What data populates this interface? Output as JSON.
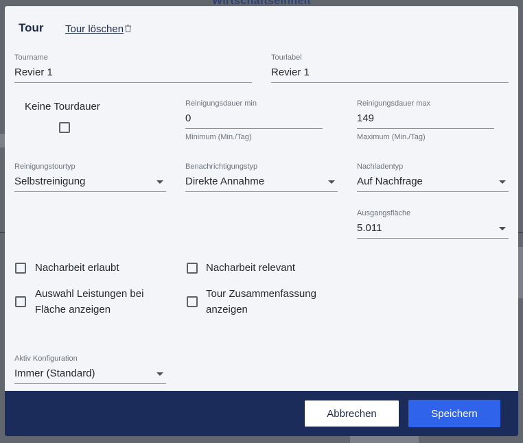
{
  "background": {
    "page_title": "Wirtschaftseinheit"
  },
  "dialog": {
    "title": "Tour",
    "delete_link": "Tour löschen",
    "tourname": {
      "label": "Tourname",
      "value": "Revier 1"
    },
    "tourlabel": {
      "label": "Tourlabel",
      "value": "Revier 1"
    },
    "keine_tourdauer": {
      "label": "Keine Tourdauer",
      "checked": false
    },
    "reinigungsdauer_min": {
      "label": "Reinigungsdauer min",
      "value": "0",
      "hint": "Minimum (Min./Tag)"
    },
    "reinigungsdauer_max": {
      "label": "Reinigungsdauer max",
      "value": "149",
      "hint": "Maximum (Min./Tag)"
    },
    "reinigungstourtyp": {
      "label": "Reinigungstourtyp",
      "value": "Selbstreinigung"
    },
    "benachrichtigungstyp": {
      "label": "Benachrichtigungstyp",
      "value": "Direkte Annahme"
    },
    "nachladentyp": {
      "label": "Nachladentyp",
      "value": "Auf Nachfrage"
    },
    "ausgangsflaeche": {
      "label": "Ausgangsfläche",
      "value": "5.011"
    },
    "checkboxes": {
      "nacharbeit_erlaubt": {
        "label": "Nacharbeit erlaubt",
        "checked": false
      },
      "nacharbeit_relevant": {
        "label": "Nacharbeit relevant",
        "checked": false
      },
      "auswahl_leistungen": {
        "line1": "Auswahl Leistungen bei",
        "line2": "Fläche anzeigen",
        "checked": false
      },
      "tour_zusammenfassung": {
        "line1": "Tour Zusammenfassung",
        "line2": "anzeigen",
        "checked": false
      }
    },
    "aktiv_konfiguration": {
      "label": "Aktiv Konfiguration",
      "value": "Immer (Standard)"
    },
    "buttons": {
      "cancel": "Abbrechen",
      "save": "Speichern"
    }
  },
  "colors": {
    "footer": "#1b2b5a",
    "primary_button": "#2e63ea",
    "title_text": "#1b2a4e",
    "dialog_bg": "#f3f5f8"
  },
  "icons": {
    "delete": "trash-icon",
    "select": "chevron-down-icon"
  }
}
